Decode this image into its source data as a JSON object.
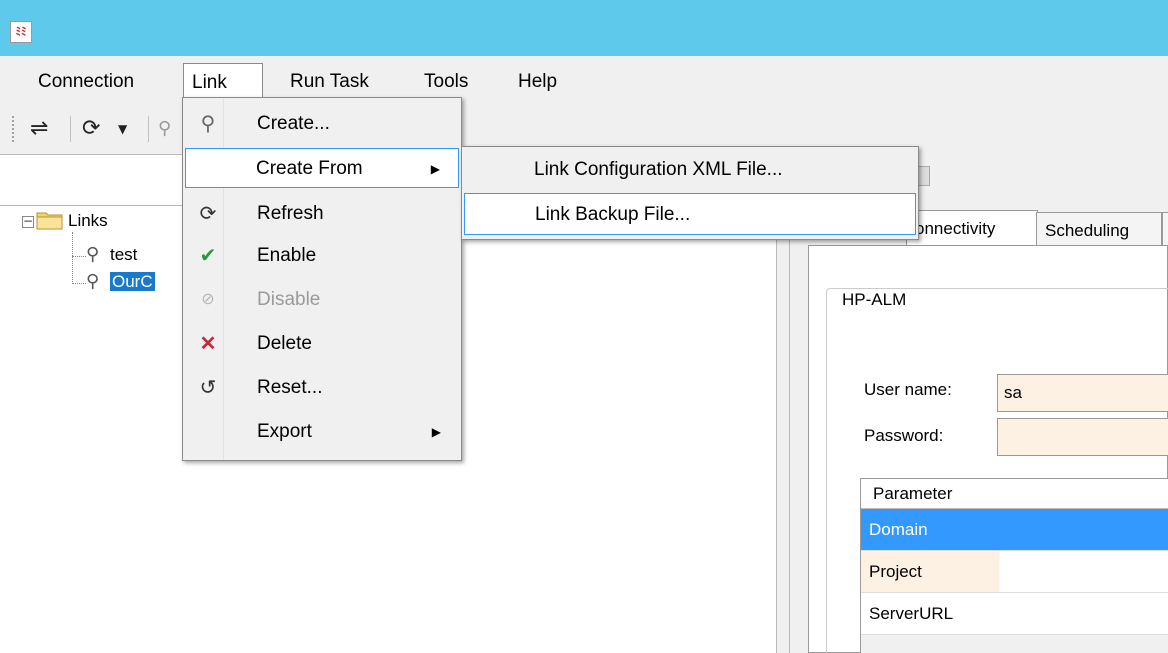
{
  "app": {
    "icon_label": "ﾐﾐ"
  },
  "menubar": {
    "items": [
      {
        "label": "Connection"
      },
      {
        "label": "Link"
      },
      {
        "label": "Run Task"
      },
      {
        "label": "Tools"
      },
      {
        "label": "Help"
      }
    ]
  },
  "link_menu": {
    "items": [
      {
        "label": "Create...",
        "icon": "create-link-icon"
      },
      {
        "label": "Create From",
        "icon": "",
        "submenu": true
      },
      {
        "label": "Refresh",
        "icon": "refresh-icon"
      },
      {
        "label": "Enable",
        "icon": "check-icon"
      },
      {
        "label": "Disable",
        "icon": "disable-icon",
        "disabled": true
      },
      {
        "label": "Delete",
        "icon": "delete-icon"
      },
      {
        "label": "Reset...",
        "icon": "reset-icon"
      },
      {
        "label": "Export",
        "icon": "",
        "submenu": true
      }
    ]
  },
  "create_from_submenu": {
    "items": [
      {
        "label": "Link Configuration XML File..."
      },
      {
        "label": "Link Backup File..."
      }
    ]
  },
  "tree": {
    "root": "Links",
    "children": [
      "test",
      "OurC"
    ]
  },
  "tabs": [
    {
      "label": "onnectivity"
    },
    {
      "label": "Scheduling"
    }
  ],
  "connection_group": {
    "title": "HP-ALM",
    "username_label": "User name:",
    "username_value": "sa",
    "password_label": "Password:",
    "password_value": ""
  },
  "param_grid": {
    "header": "Parameter",
    "rows": [
      "Domain",
      "Project",
      "ServerURL"
    ]
  },
  "colors": {
    "titlebar": "#5ec9ea",
    "selection": "#1979ca",
    "menu_hover_border": "#3399ff",
    "input_bg": "#fdf1e4"
  }
}
